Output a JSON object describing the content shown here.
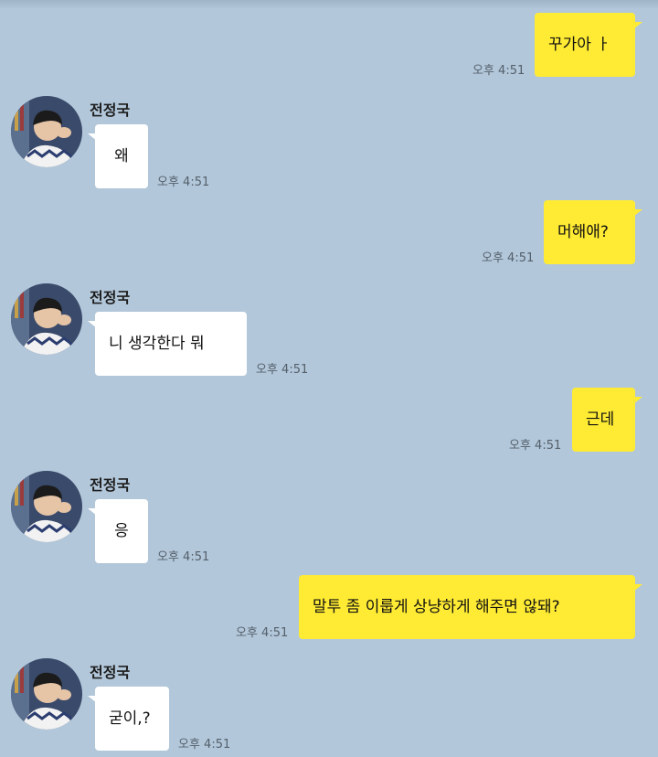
{
  "contact": {
    "name": "전정국"
  },
  "messages": [
    {
      "sender": "me",
      "text": "꾸가아 ㅏ",
      "time": "오후 4:51"
    },
    {
      "sender": "them",
      "text": "왜",
      "time": "오후 4:51"
    },
    {
      "sender": "me",
      "text": "머해애?",
      "time": "오후 4:51"
    },
    {
      "sender": "them",
      "text": "니 생각한다 뭐",
      "time": "오후 4:51"
    },
    {
      "sender": "me",
      "text": "근데",
      "time": "오후 4:51"
    },
    {
      "sender": "them",
      "text": "응",
      "time": "오후 4:51"
    },
    {
      "sender": "me",
      "text": "말투 좀 이룹게 상냥하게 해주면 않돼?",
      "time": "오후 4:51"
    },
    {
      "sender": "them",
      "text": "굳이,?",
      "time": "오후 4:51"
    }
  ],
  "colors": {
    "background": "#b2c7da",
    "my_bubble": "#ffeb33",
    "their_bubble": "#ffffff"
  }
}
